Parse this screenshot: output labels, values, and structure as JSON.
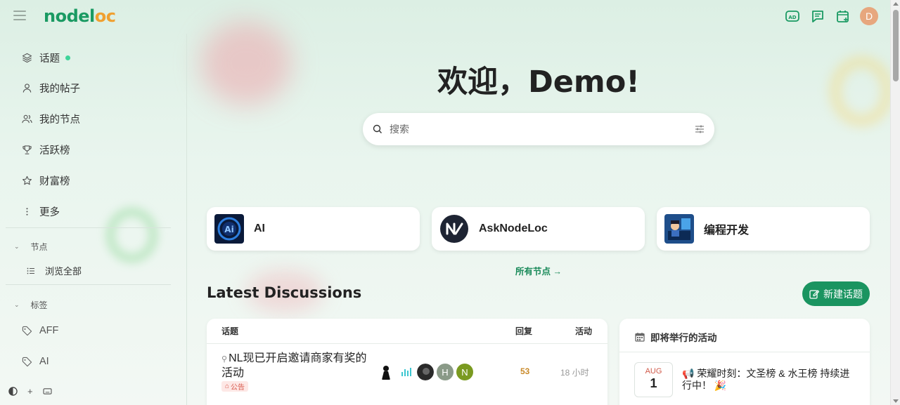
{
  "header": {
    "logo_part1": "nodel",
    "logo_part2": "oc",
    "avatar_letter": "D",
    "icons": [
      "ad-icon",
      "chat-icon",
      "calendar-plus-icon"
    ]
  },
  "sidebar": {
    "items": [
      {
        "label": "话题",
        "icon": "layers-icon",
        "has_new": true
      },
      {
        "label": "我的帖子",
        "icon": "user-icon"
      },
      {
        "label": "我的节点",
        "icon": "users-icon"
      },
      {
        "label": "活跃榜",
        "icon": "trophy-icon"
      },
      {
        "label": "财富榜",
        "icon": "star-icon"
      },
      {
        "label": "更多",
        "icon": "more-vertical-icon"
      }
    ],
    "sections": [
      {
        "title": "节点",
        "items": [
          "浏览全部"
        ]
      },
      {
        "title": "标签",
        "items": [
          "AFF",
          "AI"
        ]
      }
    ]
  },
  "main": {
    "welcome": "欢迎，Demo!",
    "search_placeholder": "搜索",
    "categories": [
      {
        "name": "AI"
      },
      {
        "name": "AskNodeLoc"
      },
      {
        "name": "编程开发"
      }
    ],
    "all_nodes_link": "所有节点 →",
    "latest_title": "Latest Discussions",
    "new_topic_label": "新建话题"
  },
  "topics": {
    "columns": [
      "话题",
      "回复",
      "活动"
    ],
    "rows": [
      {
        "title": "NL现已开启邀请商家有奖的活动",
        "tag": "公告",
        "poster_initials": [
          "H",
          "N"
        ],
        "replies": "53",
        "activity": "18 小时"
      }
    ]
  },
  "events": {
    "title": "即将举行的活动",
    "items": [
      {
        "month": "AUG",
        "day": "1",
        "title": "荣耀时刻：文圣榜 & 水王榜 持续进行中！"
      }
    ]
  },
  "colors": {
    "brand_green": "#1a9a63",
    "brand_orange": "#f0a030",
    "accent_button": "#1a9460",
    "replies_color": "#c98a2a"
  }
}
